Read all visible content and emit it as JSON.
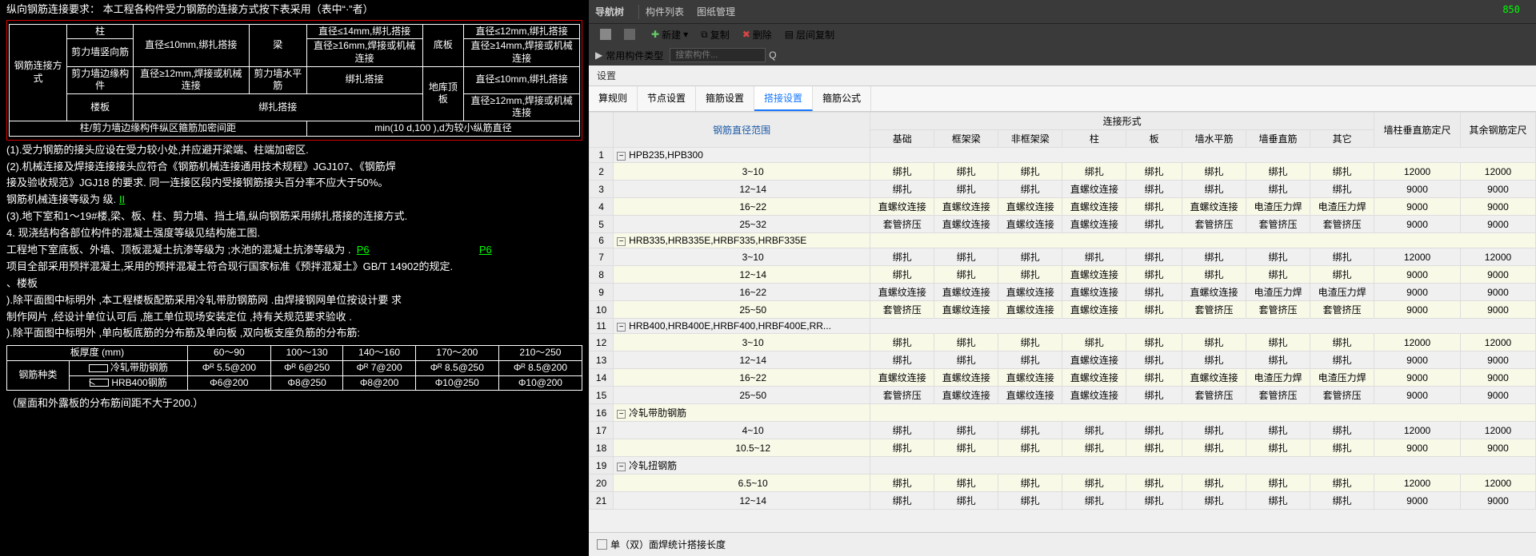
{
  "cad": {
    "title_line": "纵向钢筋连接要求：       本工程各构件受力钢筋的连接方式按下表采用（表中“·”者）",
    "table1": {
      "r1": [
        "钢筋连接方式",
        "柱",
        "直径≤10mm,绑扎搭接",
        "梁",
        "直径≤14mm,绑扎搭接",
        "底板",
        "直径≤12mm,绑扎搭接"
      ],
      "r2": [
        "剪力墙竖向筋",
        "",
        "直径≥16mm,焊接或机械连接",
        "",
        "直径≥14mm,焊接或机械连接"
      ],
      "r3": [
        "剪力墙边缘构件",
        "直径≥12mm,焊接或机械连接",
        "剪力墙水平筋",
        "绑扎搭接",
        "地库顶板",
        "直径≤10mm,绑扎搭接"
      ],
      "r4": [
        "楼板",
        "绑扎搭接",
        "",
        "",
        "",
        "直径≥12mm,焊接或机械连接"
      ],
      "r5": [
        "柱/剪力墙边缘构件纵区箍筋加密间距",
        "min(10 d,100 ),d为较小纵筋直径"
      ]
    },
    "notes": {
      "n1": "(1).受力钢筋的接头应设在受力较小处,并应避开梁端、柱端加密区.",
      "n2": "(2).机械连接及焊接连接接头应符合《钢筋机械连接通用技术规程》JGJ107、《钢筋焊",
      "n2b": "     接及验收规范》JGJ18 的要求. 同一连接区段内受接钢筋接头百分率不应大于50%。",
      "n2c": "     钢筋机械连接等级为          级.",
      "n2c_u": "II",
      "n3": "(3).地下室和1～19#楼,梁、板、柱、剪力墙、挡土墙,纵向钢筋采用绑扎搭接的连接方式.",
      "n4": "4. 现浇结构各部位构件的混凝土强度等级见结构施工图.",
      "n5l": "工程地下室底板、外墙、顶板混凝土抗渗等级为             ;水池的混凝土抗渗等级为        .",
      "n5ua": "P6",
      "n5ub": "P6",
      "n6": "项目全部采用预拌混凝土,采用的预拌混凝土符合现行国家标准《预拌混凝土》GB/T 14902的规定.",
      "n7": "、楼板",
      "n8l": ").除平面图中标明外               ,本工程楼板配筋采用冷轧带肋钢筋网               .由焊接钢网单位按设计要                求",
      "n8l2": "    制作网片        ,经设计单位认可后              ,施工单位现场安装定位              ,持有关规范要求验收            .",
      "n9": ").除平面图中标明外               ,单向板底筋的分布筋及单向板               ,双向板支座负筋的分布筋:"
    },
    "table2": {
      "header": [
        "板厚度  (mm)",
        "60～90",
        "100～130",
        "140～160",
        "170～200",
        "210～250"
      ],
      "r1_label": "钢筋种类",
      "r1a_icon_label": "冷轧带肋钢筋",
      "r1a": [
        "Φᴿ 5.5@200",
        "Φᴿ 6@250",
        "Φᴿ 7@200",
        "Φᴿ 8.5@250",
        "Φᴿ 8.5@200"
      ],
      "r1b_icon_label": "HRB400钢筋",
      "r1b": [
        "Φ6@200",
        "Φ8@250",
        "Φ8@200",
        "Φ10@250",
        "Φ10@200"
      ]
    },
    "footnote": "（屋面和外露板的分布筋间距不大于200.）"
  },
  "right_toolbar": {
    "nav_tree": "导航树",
    "comp_list": "构件列表",
    "drawing_mgr": "图纸管理",
    "new_btn": "新建",
    "copy_btn": "复制",
    "delete_btn": "删除",
    "layer_copy_btn": "层间复制",
    "search_placeholder": "搜索构件...",
    "common_types": "常用构件类型",
    "num_850": "850"
  },
  "settings_title": "设置",
  "tabs": {
    "t1": "算规则",
    "t2": "节点设置",
    "t3": "箍筋设置",
    "t4": "搭接设置",
    "t5": "箍筋公式"
  },
  "grid": {
    "range_header": "钢筋直径范围",
    "connect_header": "连接形式",
    "wall_col_v": "墙柱垂直筋定尺",
    "other_rebar": "其余钢筋定尺",
    "cols": [
      "基础",
      "框架梁",
      "非框架梁",
      "柱",
      "板",
      "墙水平筋",
      "墙垂直筋",
      "其它"
    ],
    "groups": [
      {
        "name": "HPB235,HPB300",
        "start": 1,
        "rows": [
          {
            "n": 2,
            "range": "3~10",
            "v": [
              "绑扎",
              "绑扎",
              "绑扎",
              "绑扎",
              "绑扎",
              "绑扎",
              "绑扎",
              "绑扎"
            ],
            "a": "12000",
            "b": "12000"
          },
          {
            "n": 3,
            "range": "12~14",
            "v": [
              "绑扎",
              "绑扎",
              "绑扎",
              "直螺纹连接",
              "绑扎",
              "绑扎",
              "绑扎",
              "绑扎"
            ],
            "a": "9000",
            "b": "9000"
          },
          {
            "n": 4,
            "range": "16~22",
            "v": [
              "直螺纹连接",
              "直螺纹连接",
              "直螺纹连接",
              "直螺纹连接",
              "绑扎",
              "直螺纹连接",
              "电渣压力焊",
              "电渣压力焊"
            ],
            "a": "9000",
            "b": "9000"
          },
          {
            "n": 5,
            "range": "25~32",
            "v": [
              "套管挤压",
              "直螺纹连接",
              "直螺纹连接",
              "直螺纹连接",
              "绑扎",
              "套管挤压",
              "套管挤压",
              "套管挤压"
            ],
            "a": "9000",
            "b": "9000"
          }
        ]
      },
      {
        "name": "HRB335,HRB335E,HRBF335,HRBF335E",
        "start": 6,
        "rows": [
          {
            "n": 7,
            "range": "3~10",
            "v": [
              "绑扎",
              "绑扎",
              "绑扎",
              "绑扎",
              "绑扎",
              "绑扎",
              "绑扎",
              "绑扎"
            ],
            "a": "12000",
            "b": "12000"
          },
          {
            "n": 8,
            "range": "12~14",
            "v": [
              "绑扎",
              "绑扎",
              "绑扎",
              "直螺纹连接",
              "绑扎",
              "绑扎",
              "绑扎",
              "绑扎"
            ],
            "a": "9000",
            "b": "9000"
          },
          {
            "n": 9,
            "range": "16~22",
            "v": [
              "直螺纹连接",
              "直螺纹连接",
              "直螺纹连接",
              "直螺纹连接",
              "绑扎",
              "直螺纹连接",
              "电渣压力焊",
              "电渣压力焊"
            ],
            "a": "9000",
            "b": "9000"
          },
          {
            "n": 10,
            "range": "25~50",
            "v": [
              "套管挤压",
              "直螺纹连接",
              "直螺纹连接",
              "直螺纹连接",
              "绑扎",
              "套管挤压",
              "套管挤压",
              "套管挤压"
            ],
            "a": "9000",
            "b": "9000"
          }
        ]
      },
      {
        "name": "HRB400,HRB400E,HRBF400,HRBF400E,RR...",
        "start": 11,
        "rows": [
          {
            "n": 12,
            "range": "3~10",
            "v": [
              "绑扎",
              "绑扎",
              "绑扎",
              "绑扎",
              "绑扎",
              "绑扎",
              "绑扎",
              "绑扎"
            ],
            "a": "12000",
            "b": "12000"
          },
          {
            "n": 13,
            "range": "12~14",
            "v": [
              "绑扎",
              "绑扎",
              "绑扎",
              "直螺纹连接",
              "绑扎",
              "绑扎",
              "绑扎",
              "绑扎"
            ],
            "a": "9000",
            "b": "9000"
          },
          {
            "n": 14,
            "range": "16~22",
            "v": [
              "直螺纹连接",
              "直螺纹连接",
              "直螺纹连接",
              "直螺纹连接",
              "绑扎",
              "直螺纹连接",
              "电渣压力焊",
              "电渣压力焊"
            ],
            "a": "9000",
            "b": "9000"
          },
          {
            "n": 15,
            "range": "25~50",
            "v": [
              "套管挤压",
              "直螺纹连接",
              "直螺纹连接",
              "直螺纹连接",
              "绑扎",
              "套管挤压",
              "套管挤压",
              "套管挤压"
            ],
            "a": "9000",
            "b": "9000"
          }
        ]
      },
      {
        "name": "冷轧带肋钢筋",
        "start": 16,
        "rows": [
          {
            "n": 17,
            "range": "4~10",
            "v": [
              "绑扎",
              "绑扎",
              "绑扎",
              "绑扎",
              "绑扎",
              "绑扎",
              "绑扎",
              "绑扎"
            ],
            "a": "12000",
            "b": "12000"
          },
          {
            "n": 18,
            "range": "10.5~12",
            "v": [
              "绑扎",
              "绑扎",
              "绑扎",
              "绑扎",
              "绑扎",
              "绑扎",
              "绑扎",
              "绑扎"
            ],
            "a": "9000",
            "b": "9000"
          }
        ]
      },
      {
        "name": "冷轧扭钢筋",
        "start": 19,
        "rows": [
          {
            "n": 20,
            "range": "6.5~10",
            "v": [
              "绑扎",
              "绑扎",
              "绑扎",
              "绑扎",
              "绑扎",
              "绑扎",
              "绑扎",
              "绑扎"
            ],
            "a": "12000",
            "b": "12000"
          },
          {
            "n": 21,
            "range": "12~14",
            "v": [
              "绑扎",
              "绑扎",
              "绑扎",
              "绑扎",
              "绑扎",
              "绑扎",
              "绑扎",
              "绑扎"
            ],
            "a": "9000",
            "b": "9000"
          }
        ]
      }
    ]
  },
  "bottom_checkbox_label": "单（双）面焊统计搭接长度"
}
